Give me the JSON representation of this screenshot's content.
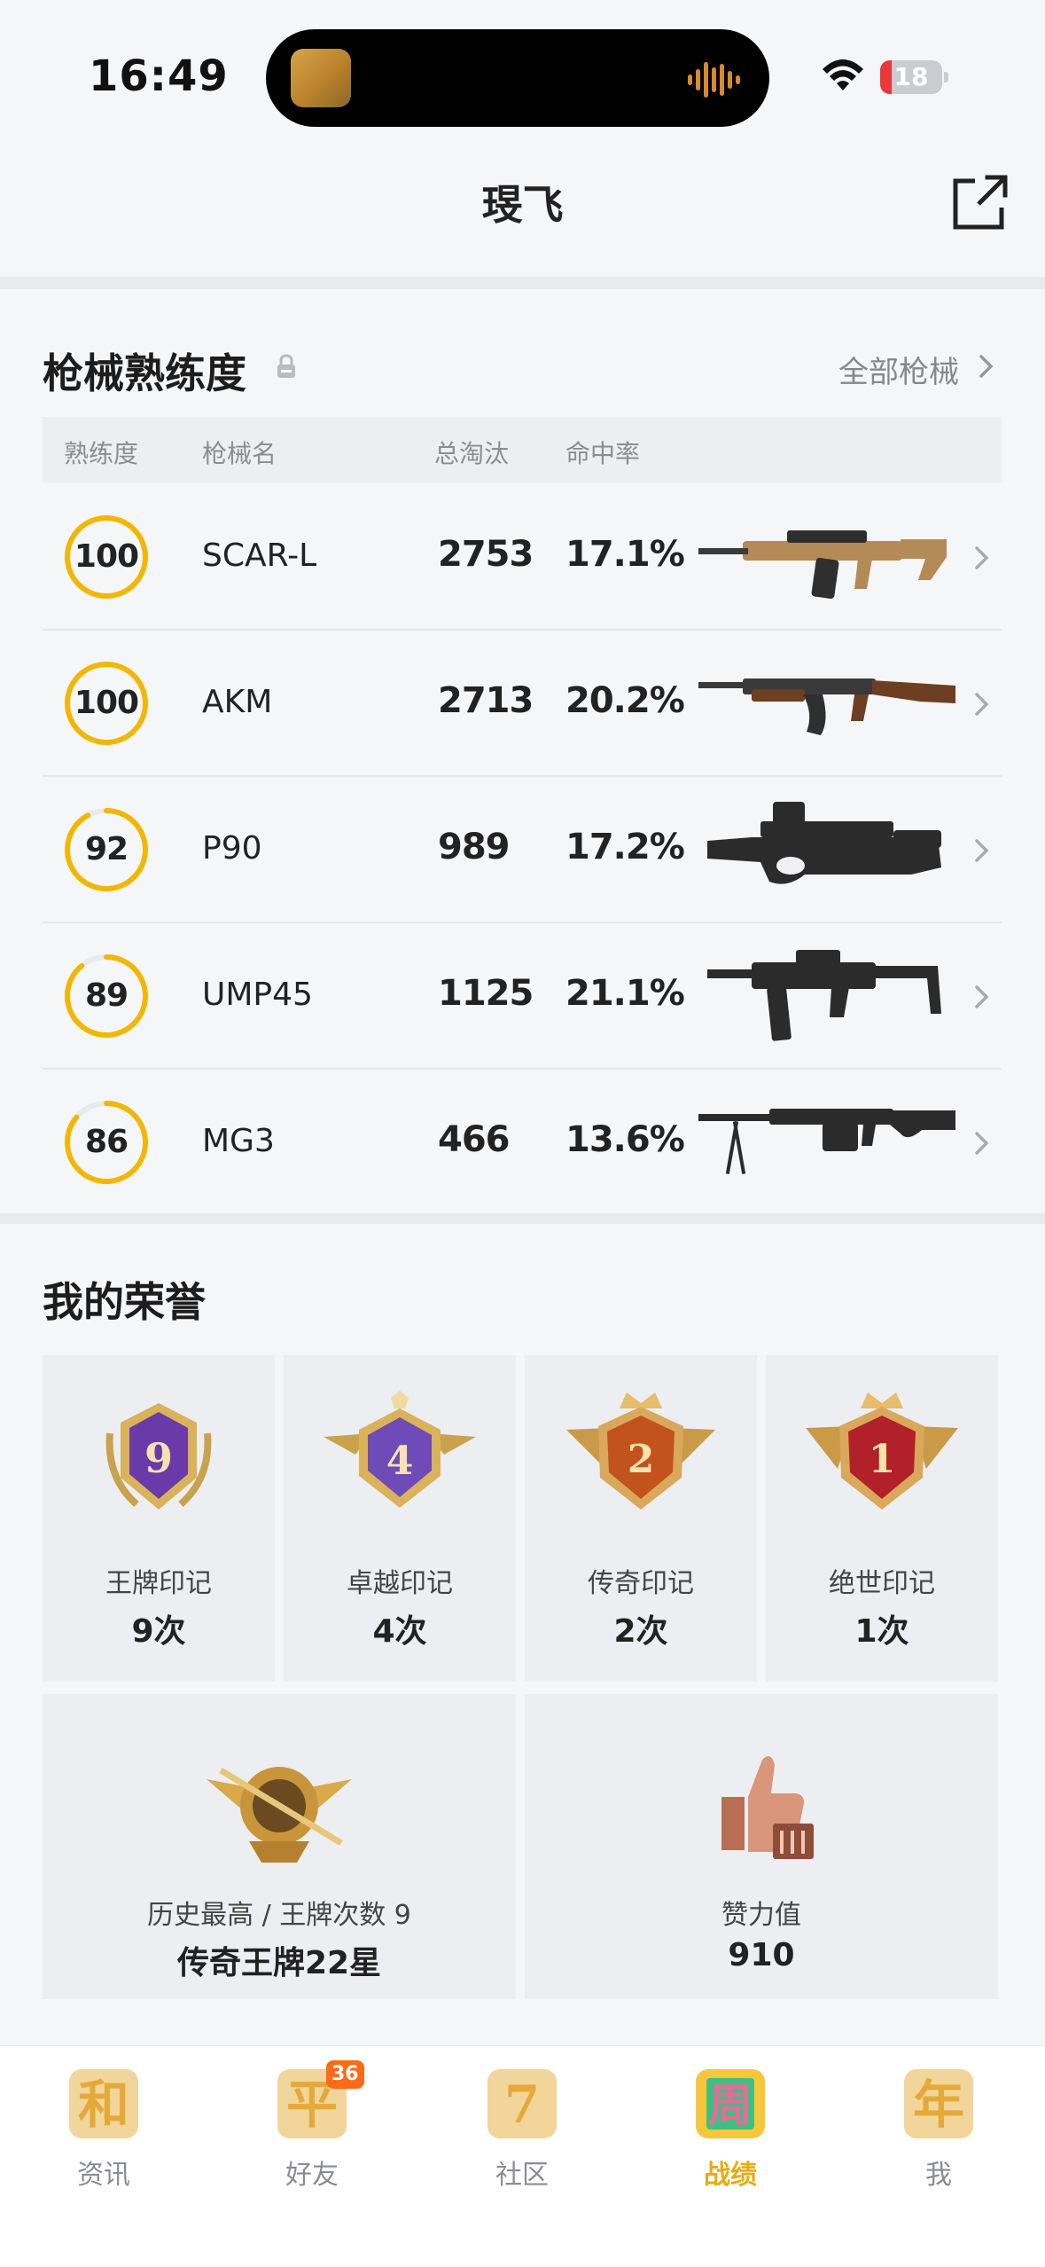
{
  "status_bar": {
    "time": "16:49",
    "battery": "18",
    "battery_level": 0.18
  },
  "header": {
    "title": "琝飞"
  },
  "weapons": {
    "title": "枪械熟练度",
    "all_link": "全部枪械",
    "columns": [
      "熟练度",
      "枪械名",
      "总淘汰",
      "命中率"
    ],
    "rows": [
      {
        "proficiency": "100",
        "proficiency_value": 100,
        "name": "SCAR-L",
        "kills": "2753",
        "accuracy": "17.1%",
        "gun_icon": "assault-rifle-tan"
      },
      {
        "proficiency": "100",
        "proficiency_value": 100,
        "name": "AKM",
        "kills": "2713",
        "accuracy": "20.2%",
        "gun_icon": "assault-rifle-wood"
      },
      {
        "proficiency": "92",
        "proficiency_value": 92,
        "name": "P90",
        "kills": "989",
        "accuracy": "17.2%",
        "gun_icon": "smg-bullpup"
      },
      {
        "proficiency": "89",
        "proficiency_value": 89,
        "name": "UMP45",
        "kills": "1125",
        "accuracy": "21.1%",
        "gun_icon": "smg-folding-stock"
      },
      {
        "proficiency": "86",
        "proficiency_value": 86,
        "name": "MG3",
        "kills": "466",
        "accuracy": "13.6%",
        "gun_icon": "machine-gun-bipod"
      }
    ]
  },
  "honors": {
    "title": "我的荣誉",
    "marks": [
      {
        "badge_number": "9",
        "label": "王牌印记",
        "value": "9次",
        "color": "#6a3aa8"
      },
      {
        "badge_number": "4",
        "label": "卓越印记",
        "value": "4次",
        "color": "#6f4bb8"
      },
      {
        "badge_number": "2",
        "label": "传奇印记",
        "value": "2次",
        "color": "#c2531c"
      },
      {
        "badge_number": "1",
        "label": "绝世印记",
        "value": "1次",
        "color": "#b2202a"
      }
    ],
    "highest": {
      "label": "历史最高 / 王牌次数 9",
      "value": "传奇王牌22星"
    },
    "likes": {
      "label": "赞力值",
      "value": "910"
    }
  },
  "tabbar": {
    "accent": "#e6ac10",
    "tabs": [
      {
        "icon_text": "和",
        "label": "资讯",
        "active": false
      },
      {
        "icon_text": "平",
        "label": "好友",
        "badge": "36",
        "active": false
      },
      {
        "icon_text": "7",
        "label": "社区",
        "active": false
      },
      {
        "icon_text": "周",
        "label": "战绩",
        "active": true
      },
      {
        "icon_text": "年",
        "label": "我",
        "active": false
      }
    ]
  }
}
